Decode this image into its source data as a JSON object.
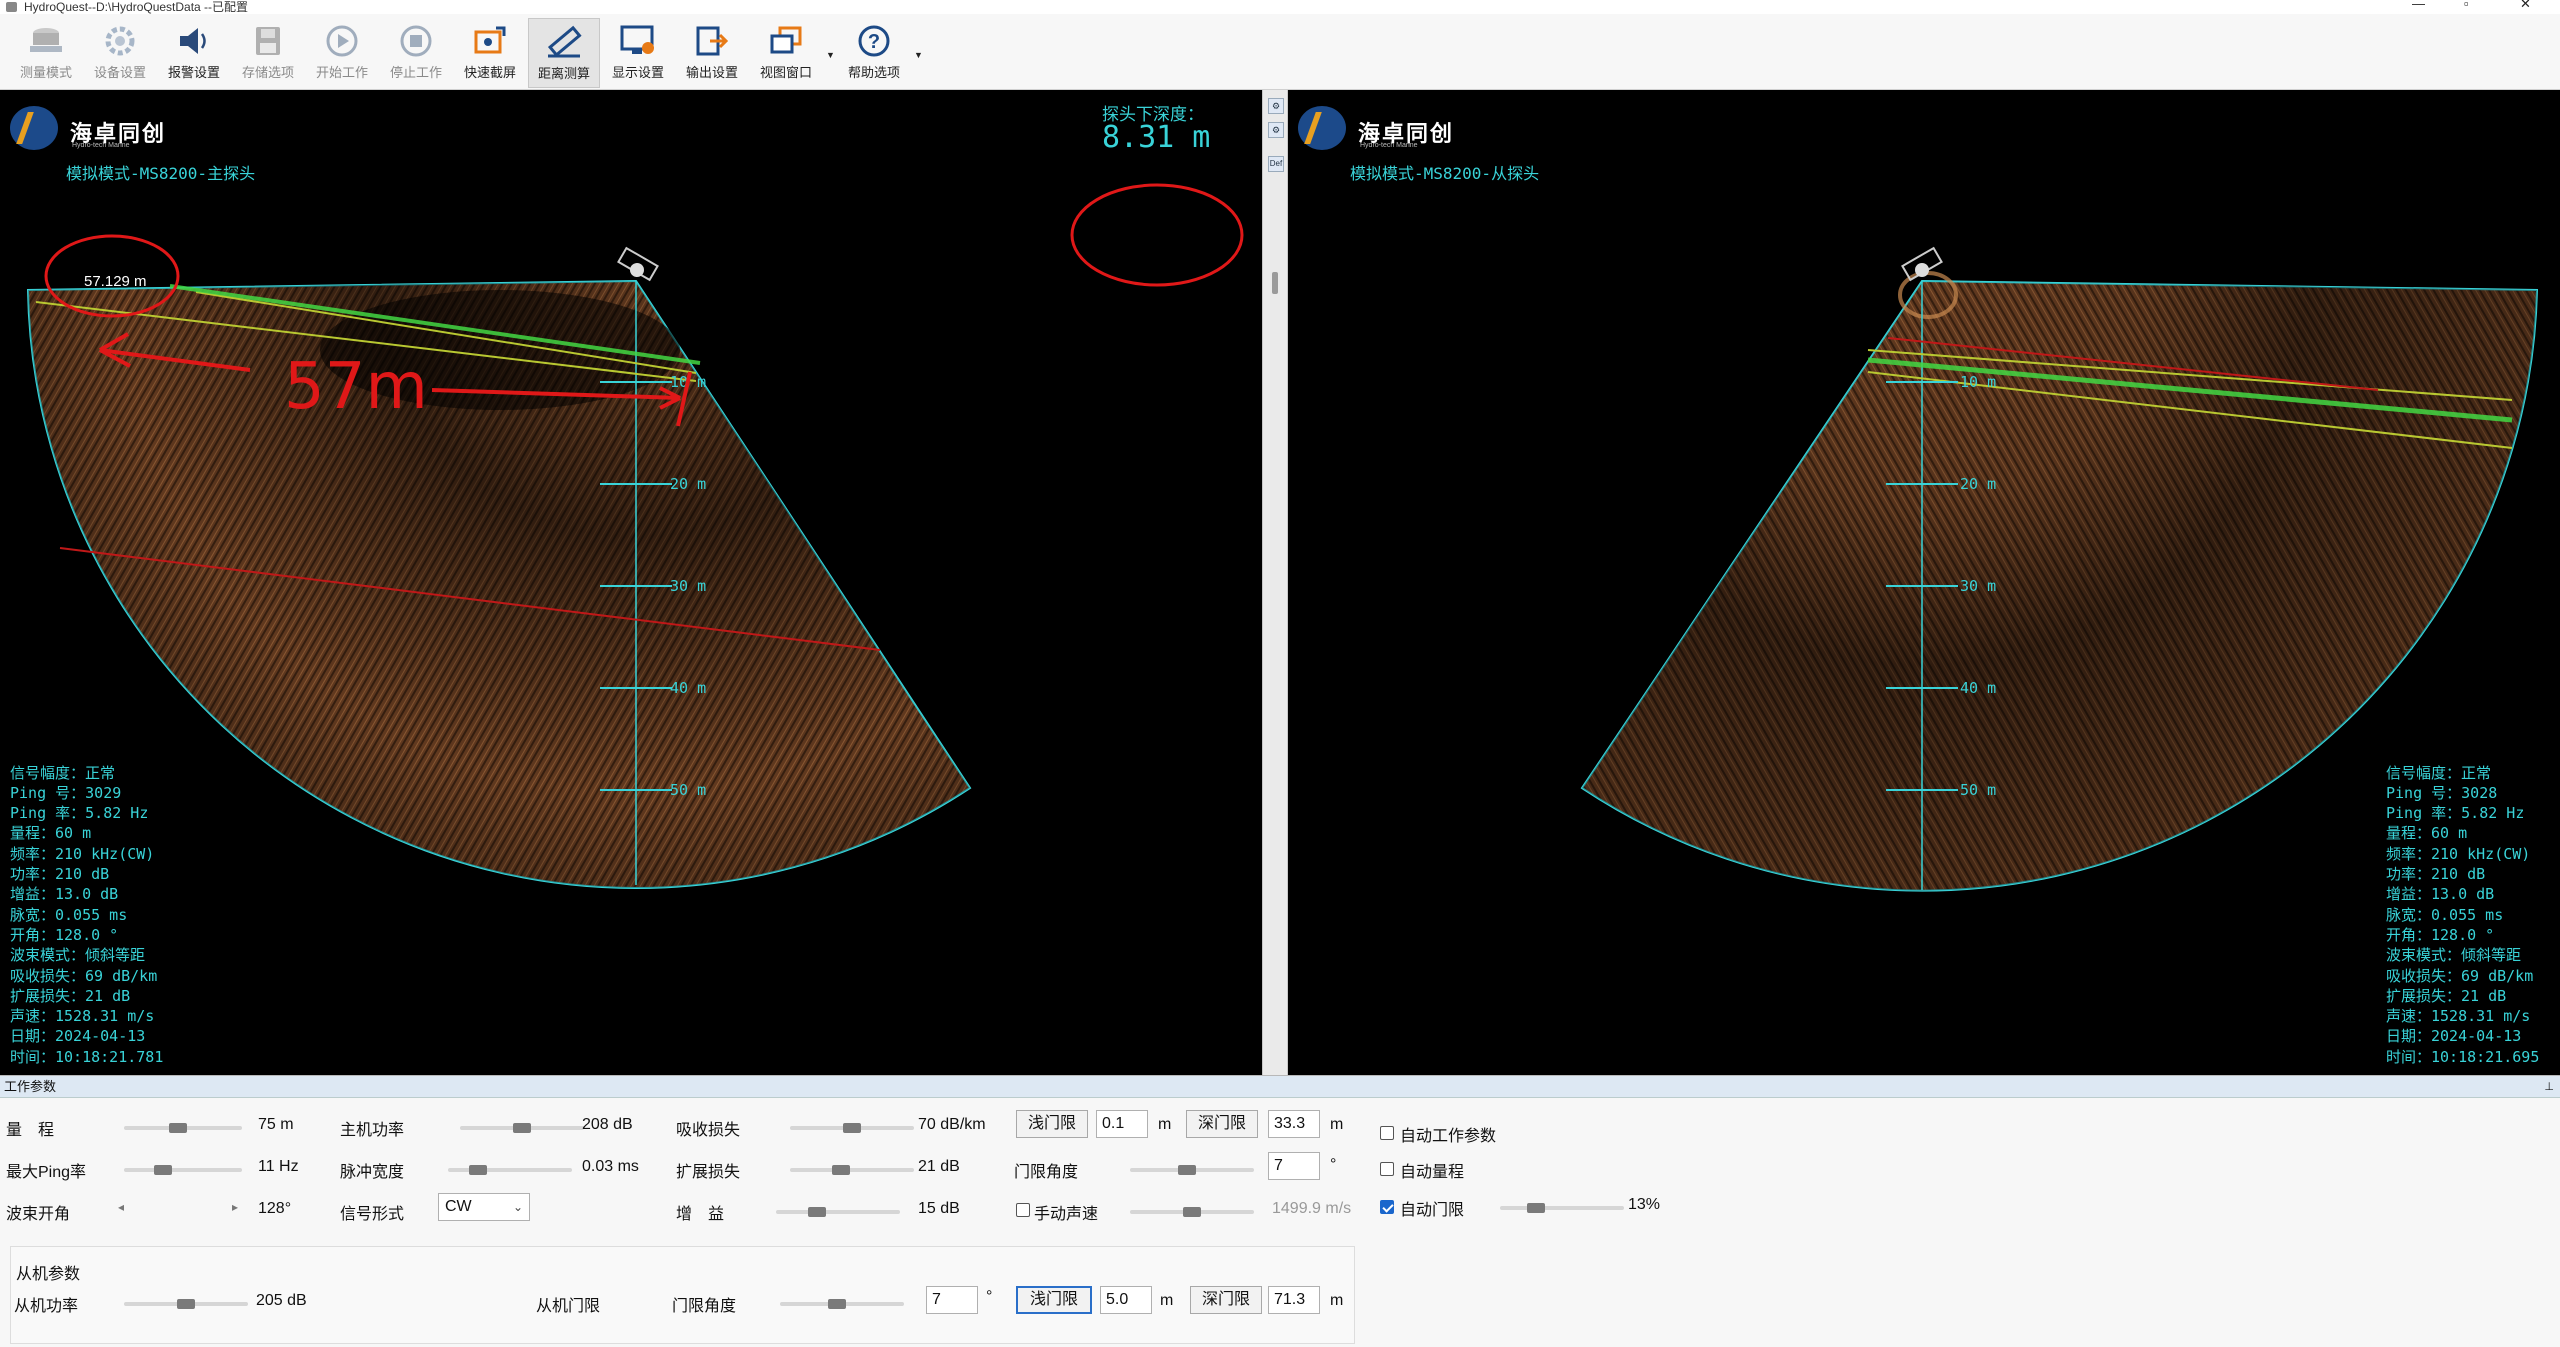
{
  "window": {
    "title": "HydroQuest--D:\\HydroQuestData --已配置"
  },
  "toolbar": {
    "items": [
      {
        "id": "measure_mode",
        "label": "测量模式",
        "icon": "sonar-icon",
        "enabled": false
      },
      {
        "id": "device_settings",
        "label": "设备设置",
        "icon": "gear-icon",
        "enabled": false
      },
      {
        "id": "alarm_settings",
        "label": "报警设置",
        "icon": "speaker-icon",
        "enabled": true
      },
      {
        "id": "storage_options",
        "label": "存储选项",
        "icon": "save-icon",
        "enabled": false
      },
      {
        "id": "start_work",
        "label": "开始工作",
        "icon": "play-icon",
        "enabled": false
      },
      {
        "id": "stop_work",
        "label": "停止工作",
        "icon": "stop-icon",
        "enabled": false
      },
      {
        "id": "quick_screenshot",
        "label": "快速截屏",
        "icon": "camera-icon",
        "enabled": true
      },
      {
        "id": "distance_measure",
        "label": "距离测算",
        "icon": "ruler-icon",
        "enabled": true,
        "active": true
      },
      {
        "id": "display_settings",
        "label": "显示设置",
        "icon": "monitor-gear-icon",
        "enabled": true
      },
      {
        "id": "output_settings",
        "label": "输出设置",
        "icon": "export-icon",
        "enabled": true
      },
      {
        "id": "view_window",
        "label": "视图窗口",
        "icon": "windows-icon",
        "enabled": true,
        "dropdown": true
      },
      {
        "id": "help_options",
        "label": "帮助选项",
        "icon": "help-icon",
        "enabled": true,
        "dropdown": true
      }
    ]
  },
  "main_panel": {
    "logo_name": "海卓同创",
    "logo_sub": "Hydro-tech Marine",
    "mode_label": "模拟模式-MS8200-主探头",
    "depth_label": "探头下深度：",
    "depth_value": "8.31  m",
    "annotation_distance": "57.129 m",
    "handwritten_note": "57m",
    "depth_ticks": [
      "10 m",
      "20 m",
      "30 m",
      "40 m",
      "50 m"
    ],
    "info_lines": [
      "信号幅度：正常",
      "Ping 号：3029",
      "Ping 率：5.82 Hz",
      "量程：60 m",
      "频率：210 kHz(CW)",
      "功率：210 dB",
      "增益：13.0 dB",
      "脉宽：0.055 ms",
      "开角：128.0 °",
      "波束模式：倾斜等距",
      "吸收损失：69 dB/km",
      "扩展损失：21 dB",
      "声速：1528.31 m/s",
      "日期：2024-04-13",
      "时间：10:18:21.781"
    ]
  },
  "slave_panel": {
    "logo_name": "海卓同创",
    "logo_sub": "Hydro-tech Marine",
    "mode_label": "模拟模式-MS8200-从探头",
    "depth_ticks": [
      "10 m",
      "20 m",
      "30 m",
      "40 m",
      "50 m"
    ],
    "info_lines": [
      "信号幅度：正常",
      "Ping 号：3028",
      "Ping 率：5.82 Hz",
      "量程：60 m",
      "频率：210 kHz(CW)",
      "功率：210 dB",
      "增益：13.0 dB",
      "脉宽：0.055 ms",
      "开角：128.0 °",
      "波束模式：倾斜等距",
      "吸收损失：69 dB/km",
      "扩展损失：21 dB",
      "声速：1528.31 m/s",
      "日期：2024-04-13",
      "时间：10:18:21.695"
    ]
  },
  "splitter": {
    "buttons": [
      "⚙",
      "⚙",
      "Def"
    ]
  },
  "params": {
    "title": "工作参数",
    "range": {
      "label": "量　程",
      "value": "75 m",
      "level": 0.45
    },
    "max_ping": {
      "label": "最大Ping率",
      "value": "11 Hz",
      "level": 0.3
    },
    "beam_angle": {
      "label": "波束开角",
      "value": "128°",
      "left_arrow": "◂",
      "right_arrow": "▸"
    },
    "main_power": {
      "label": "主机功率",
      "value": "208 dB",
      "level": 0.5
    },
    "pulse_width": {
      "label": "脉冲宽度",
      "value": "0.03 ms",
      "level": 0.2
    },
    "signal_form": {
      "label": "信号形式",
      "value": "CW",
      "arrow": "⌄"
    },
    "absorption": {
      "label": "吸收损失",
      "value": "70 dB/km",
      "level": 0.5
    },
    "spreading": {
      "label": "扩展损失",
      "value": "21 dB",
      "level": 0.4
    },
    "gain": {
      "label": "增　益",
      "value": "15 dB",
      "level": 0.3
    },
    "gate_shallow": {
      "label": "浅门限",
      "value": "0.1",
      "unit": "m"
    },
    "gate_deep": {
      "label": "深门限",
      "value": "33.3",
      "unit": "m"
    },
    "gate_angle": {
      "label": "门限角度",
      "value": "7",
      "unit": "°",
      "level": 0.45
    },
    "manual_sound_speed": {
      "label": "手动声速",
      "checked": false,
      "value": "1499.9 m/s",
      "level": 0.5
    },
    "auto_work_params": {
      "label": "自动工作参数",
      "checked": false
    },
    "auto_range": {
      "label": "自动量程",
      "checked": false
    },
    "auto_gate": {
      "label": "自动门限",
      "checked": true,
      "value": "13%",
      "level": 0.25
    },
    "slave": {
      "title": "从机参数",
      "power": {
        "label": "从机功率",
        "value": "205 dB",
        "level": 0.5
      },
      "gate_label": "从机门限",
      "gate_angle": {
        "label": "门限角度",
        "value": "7",
        "unit": "°",
        "level": 0.45
      },
      "gate_shallow": {
        "label": "浅门限",
        "value": "5.0",
        "unit": "m"
      },
      "gate_deep": {
        "label": "深门限",
        "value": "71.3",
        "unit": "m"
      }
    }
  }
}
